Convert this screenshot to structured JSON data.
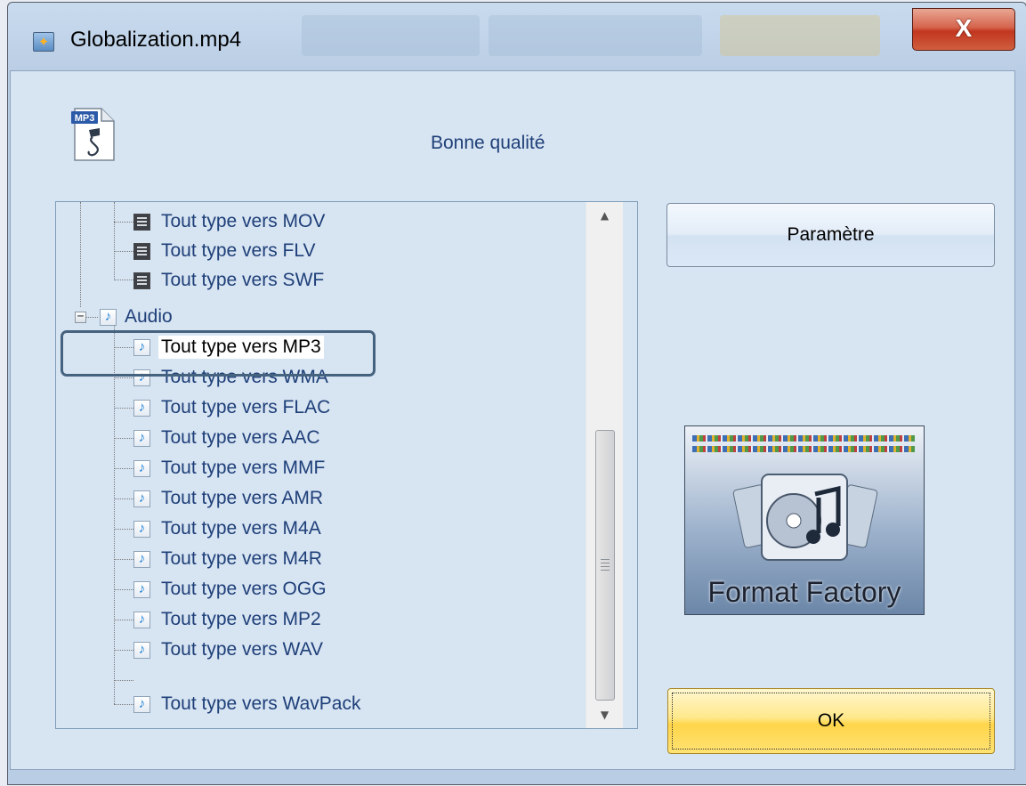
{
  "window": {
    "title": "Globalization.mp4",
    "close_label": "X"
  },
  "header": {
    "file_icon_badge": "MP3",
    "quality_label": "Bonne qualité"
  },
  "tree": {
    "video_items": [
      {
        "label": "Tout type vers MOV",
        "icon": "video-file-icon"
      },
      {
        "label": "Tout type vers FLV",
        "icon": "video-file-icon"
      },
      {
        "label": "Tout type vers SWF",
        "icon": "video-file-icon"
      }
    ],
    "audio_group": {
      "label": "Audio",
      "expander": "−",
      "icon": "audio-note-icon"
    },
    "audio_items": [
      {
        "label": "Tout type vers MP3",
        "selected": true
      },
      {
        "label": "Tout type vers WMA"
      },
      {
        "label": "Tout type vers FLAC"
      },
      {
        "label": "Tout type vers AAC"
      },
      {
        "label": "Tout type vers MMF"
      },
      {
        "label": "Tout type vers AMR"
      },
      {
        "label": "Tout type vers M4A"
      },
      {
        "label": "Tout type vers M4R"
      },
      {
        "label": "Tout type vers OGG"
      },
      {
        "label": "Tout type vers MP2"
      },
      {
        "label": "Tout type vers WAV"
      },
      {
        "label": "Tout type vers WavPack"
      }
    ],
    "note_glyph": "♪"
  },
  "buttons": {
    "settings_label": "Paramètre",
    "ok_label": "OK"
  },
  "logo": {
    "text": "Format Factory"
  },
  "colors": {
    "accent_text": "#1e3f78",
    "highlight_border": "#45627e",
    "close_red": "#c2361f",
    "ok_yellow": "#ffd54a"
  }
}
